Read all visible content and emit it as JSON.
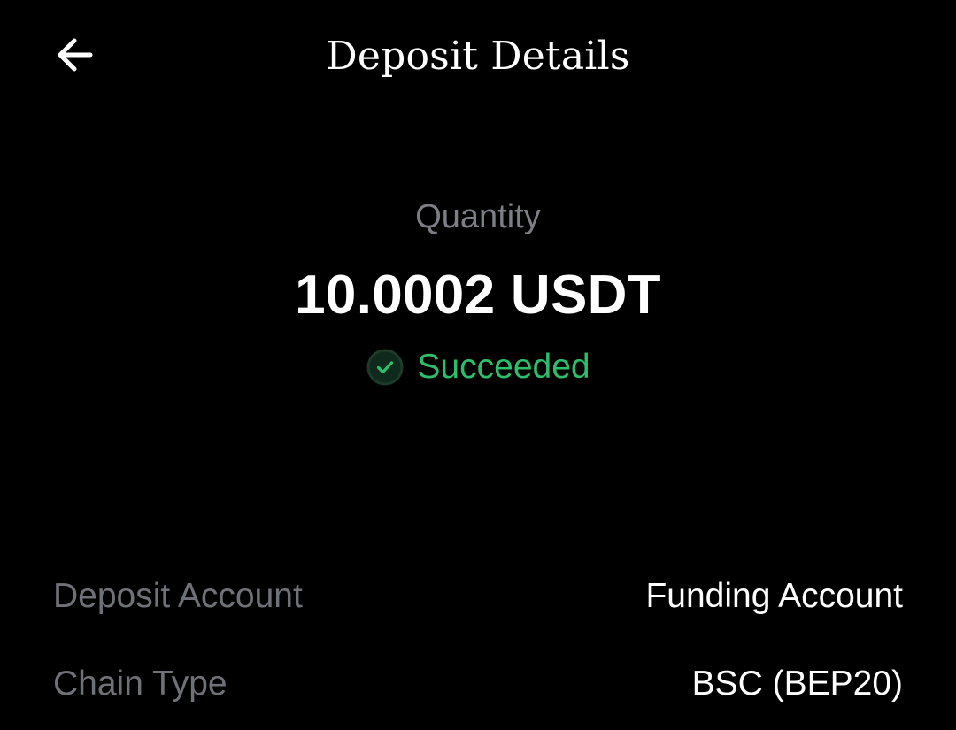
{
  "header": {
    "title": "Deposit Details",
    "back_icon": "arrow-left-icon"
  },
  "summary": {
    "quantity_label": "Quantity",
    "quantity_value": "10.0002 USDT",
    "status_text": "Succeeded",
    "status_icon": "check-circle-icon",
    "status_color": "#2ebd6a"
  },
  "details": [
    {
      "label": "Deposit Account",
      "value": "Funding Account"
    },
    {
      "label": "Chain Type",
      "value": "BSC (BEP20)"
    }
  ],
  "colors": {
    "background": "#000000",
    "muted_text": "#7d7f86",
    "primary_text": "#ffffff",
    "success": "#2ebd6a"
  }
}
